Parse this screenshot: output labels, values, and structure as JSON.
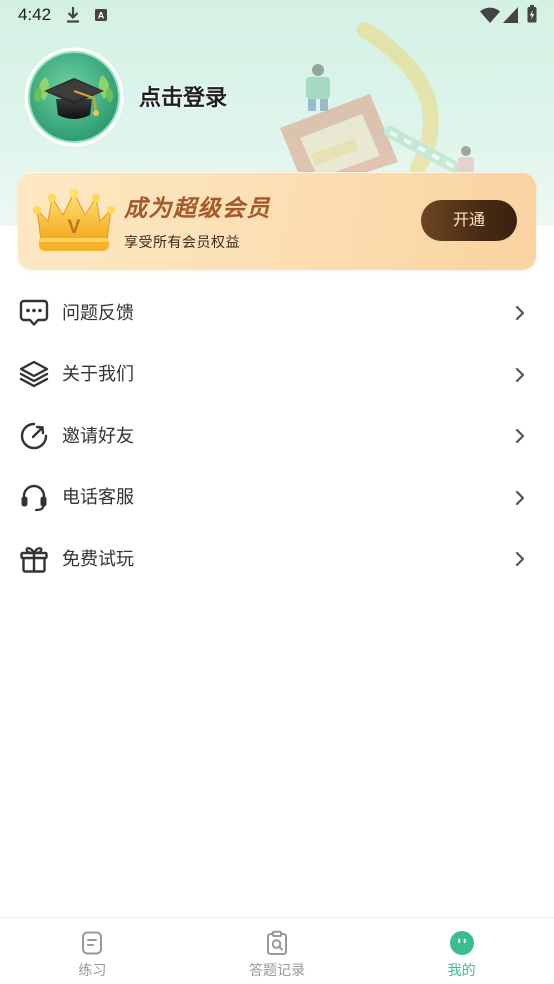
{
  "status_bar": {
    "time": "4:42",
    "notification_letter": "A",
    "icons": [
      "download-icon",
      "notification-a-icon",
      "wifi-icon",
      "signal-icon",
      "battery-icon"
    ]
  },
  "profile": {
    "login_label": "点击登录"
  },
  "vip_card": {
    "crown_letter": "V",
    "title": "成为超级会员",
    "subtitle": "享受所有会员权益",
    "open_button_label": "开通"
  },
  "menu": [
    {
      "label": "问题反馈",
      "icon": "feedback-icon"
    },
    {
      "label": "关于我们",
      "icon": "layers-icon"
    },
    {
      "label": "邀请好友",
      "icon": "invite-icon"
    },
    {
      "label": "电话客服",
      "icon": "headset-icon"
    },
    {
      "label": "免费试玩",
      "icon": "gift-icon"
    }
  ],
  "bottom_nav": [
    {
      "label": "练习",
      "icon": "practice-icon",
      "active": false
    },
    {
      "label": "答题记录",
      "icon": "records-icon",
      "active": false
    },
    {
      "label": "我的",
      "icon": "mine-icon",
      "active": true
    }
  ],
  "colors": {
    "accent": "#3cbd8e",
    "text": "#333333",
    "inactive": "#999999",
    "vip_title": "#a5582a",
    "vip_button": "#4a2c14",
    "header_bg": "#d4f1e4"
  }
}
